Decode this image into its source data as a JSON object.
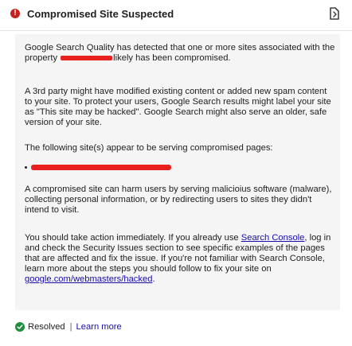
{
  "header": {
    "title": "Compromised Site Suspected",
    "alert_icon": "error-icon",
    "alert_color": "#c5221f",
    "export_icon": "export-icon"
  },
  "message": {
    "p1_before": "Google Search Quality has detected that one or more sites associated with the property ",
    "p1_after": "likely has been compromised.",
    "p2": "A 3rd party might have modified existing content or added new spam content to your site. To protect your users, Google Search results might label your site as \"This site may be hacked\". Google Search might also serve an older, safe version of your site.",
    "p3": "The following site(s) appear to be serving compromised pages:",
    "p4": "A compromised site can harm users by serving malicioius software (malware), collecting personal information, or by redirecting users to sites they didn't intend to visit.",
    "p5_part1": "You should take action immediately. If you already use ",
    "p5_link1": "Search Console",
    "p5_part2": ", log in and check the Security Issues section to see specific examples of the pages that are affected and fix the issue. If you're not familiar with Search Console, learn more about the steps you should follow to fix your site on ",
    "p5_link2": "google.com/webmasters/hacked",
    "p5_part3": "."
  },
  "footer": {
    "resolved_label": "Resolved",
    "separator": "|",
    "learn_more_label": "Learn more",
    "resolved_icon": "check-circle-icon",
    "resolved_color": "#1e8e3e"
  },
  "colors": {
    "redaction": "#e8211e",
    "link": "#1a0dab",
    "panel_bg": "#f5f5f5"
  }
}
